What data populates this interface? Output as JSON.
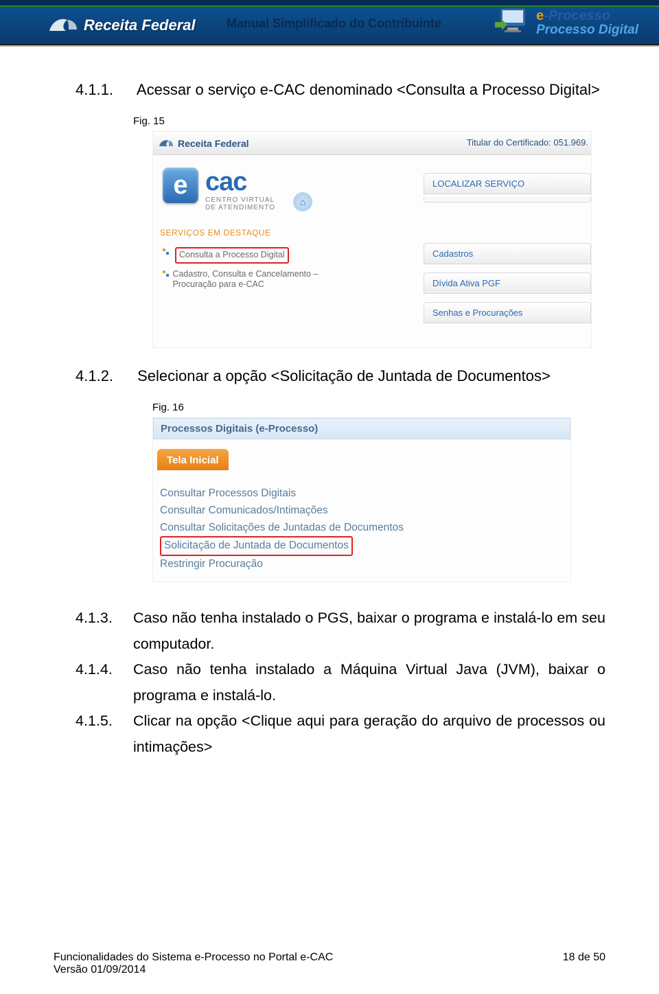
{
  "header": {
    "brand": "Receita Federal",
    "doc_title": "Manual Simplificado do Contribuinte",
    "eproc_line1_prefix": "e",
    "eproc_line1": "-Processo",
    "eproc_line2": "Processo Digital"
  },
  "sec411": {
    "num": "4.1.1.",
    "title": "Acessar o serviço e-CAC denominado <Consulta a Processo Digital>",
    "fig_label": "Fig. 15"
  },
  "fig15": {
    "brand_small": "Receita Federal",
    "titular": "Titular do Certificado: 051.969.",
    "ecac_e": "e",
    "ecac_cac": "cac",
    "ecac_sub1": "CENTRO VIRTUAL",
    "ecac_sub2": "DE ATENDIMENTO",
    "localizar": "LOCALIZAR SERVIÇO",
    "destaque_hdr": "SERVIÇOS EM DESTAQUE",
    "items_left": [
      "Consulta a Processo Digital",
      "Cadastro, Consulta e Cancelamento – Procuração para e-CAC"
    ],
    "items_right": [
      "Cadastros",
      "Dívida Ativa PGF",
      "Senhas e Procurações"
    ]
  },
  "sec412": {
    "num": "4.1.2.",
    "title": "Selecionar a opção <Solicitação de Juntada de Documentos>",
    "fig_label": "Fig. 16"
  },
  "fig16": {
    "crumb": "Processos Digitais (e-Processo)",
    "tab": "Tela Inicial",
    "opts": [
      "Consultar Processos Digitais",
      "Consultar Comunicados/Intimações",
      "Consultar Solicitações de Juntadas de Documentos",
      "Solicitação de Juntada de Documentos",
      "Restringir Procuração"
    ]
  },
  "steps": {
    "s413_num": "4.1.3.",
    "s413_txt": "Caso não tenha instalado o PGS, baixar o programa e instalá-lo em seu computador.",
    "s414_num": "4.1.4.",
    "s414_txt": "Caso não tenha instalado a Máquina Virtual Java (JVM), baixar o programa e instalá-lo.",
    "s415_num": "4.1.5.",
    "s415_txt": "Clicar na opção <Clique aqui para geração do arquivo de processos ou intimações>"
  },
  "footer": {
    "left1": "Funcionalidades do Sistema e-Processo no Portal e-CAC",
    "left2": "Versão  01/09/2014",
    "right": "18 de 50"
  }
}
